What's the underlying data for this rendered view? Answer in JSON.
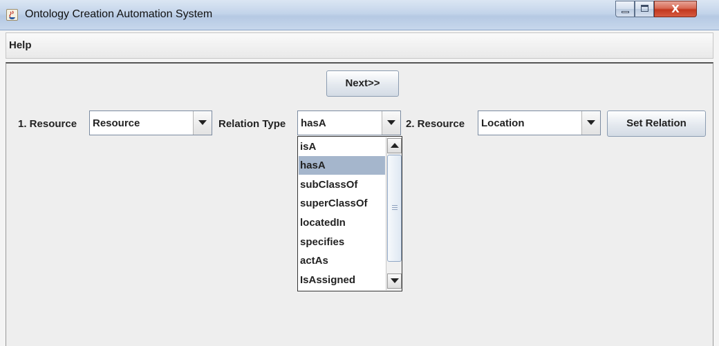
{
  "window": {
    "title": "Ontology Creation Automation System",
    "close_glyph": "X",
    "icon": "java-cup-icon"
  },
  "menu": {
    "items": [
      {
        "label": "Help"
      }
    ]
  },
  "main": {
    "next_button": "Next>>",
    "resource1_label": "1. Resource",
    "resource1_value": "Resource",
    "relation_label": "Relation Type",
    "relation_value": "hasA",
    "resource2_label": "2. Resource",
    "resource2_value": "Location",
    "set_relation_button": "Set Relation"
  },
  "relation_dropdown": {
    "selected": "hasA",
    "options": [
      "isA",
      "hasA",
      "subClassOf",
      "superClassOf",
      "locatedIn",
      "specifies",
      "actAs",
      "IsAssigned"
    ]
  },
  "colors": {
    "selection": "#a5b6cc",
    "close_button": "#c2381f"
  }
}
